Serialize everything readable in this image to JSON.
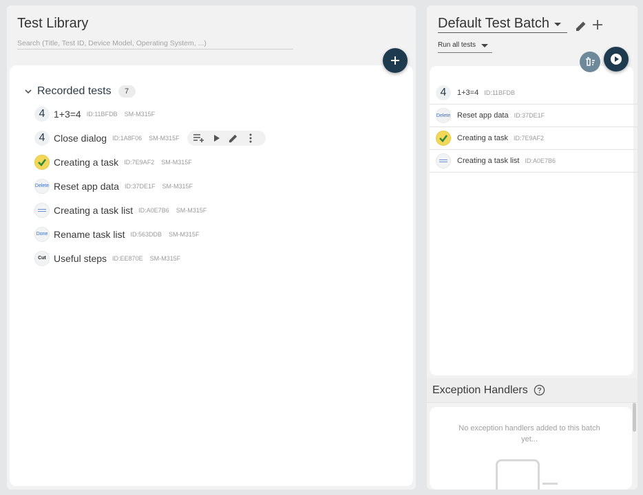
{
  "library": {
    "title": "Test Library",
    "search_placeholder": "Search (Title, Test ID, Device Model, Operating System, ...)",
    "group": {
      "label": "Recorded tests",
      "count": "7"
    },
    "tests": [
      {
        "title": "1+3=4",
        "id": "ID:11BFDB",
        "device": "SM-M315F",
        "thumb": "4"
      },
      {
        "title": "Close dialog",
        "id": "ID:1A8F06",
        "device": "SM-M315F",
        "thumb": "4"
      },
      {
        "title": "Creating a task",
        "id": "ID:7E9AF2",
        "device": "SM-M315F",
        "thumb": "check"
      },
      {
        "title": "Reset app data",
        "id": "ID:37DE1F",
        "device": "SM-M315F",
        "thumb": "Delete"
      },
      {
        "title": "Creating a task list",
        "id": "ID:A0E7B6",
        "device": "SM-M315F",
        "thumb": "lines"
      },
      {
        "title": "Rename task list",
        "id": "ID:563DDB",
        "device": "SM-M315F",
        "thumb": "Done"
      },
      {
        "title": "Useful steps",
        "id": "ID:EE870E",
        "device": "SM-M315F",
        "thumb": "Cut"
      }
    ]
  },
  "batch": {
    "title": "Default Test Batch",
    "run_mode": "Run all tests",
    "tests": [
      {
        "title": "1+3=4",
        "id": "ID:11BFDB",
        "thumb": "4"
      },
      {
        "title": "Reset app data",
        "id": "ID:37DE1F",
        "thumb": "Delete"
      },
      {
        "title": "Creating a task",
        "id": "ID:7E9AF2",
        "thumb": "check"
      },
      {
        "title": "Creating a task list",
        "id": "ID:A0E7B6",
        "thumb": "lines"
      }
    ]
  },
  "exceptions": {
    "title": "Exception Handlers",
    "empty_text": "No exception handlers added to this batch yet..."
  },
  "colors": {
    "primary": "#1e3a4f",
    "secondary": "#6e8a9a",
    "check": "#f2d75a"
  }
}
